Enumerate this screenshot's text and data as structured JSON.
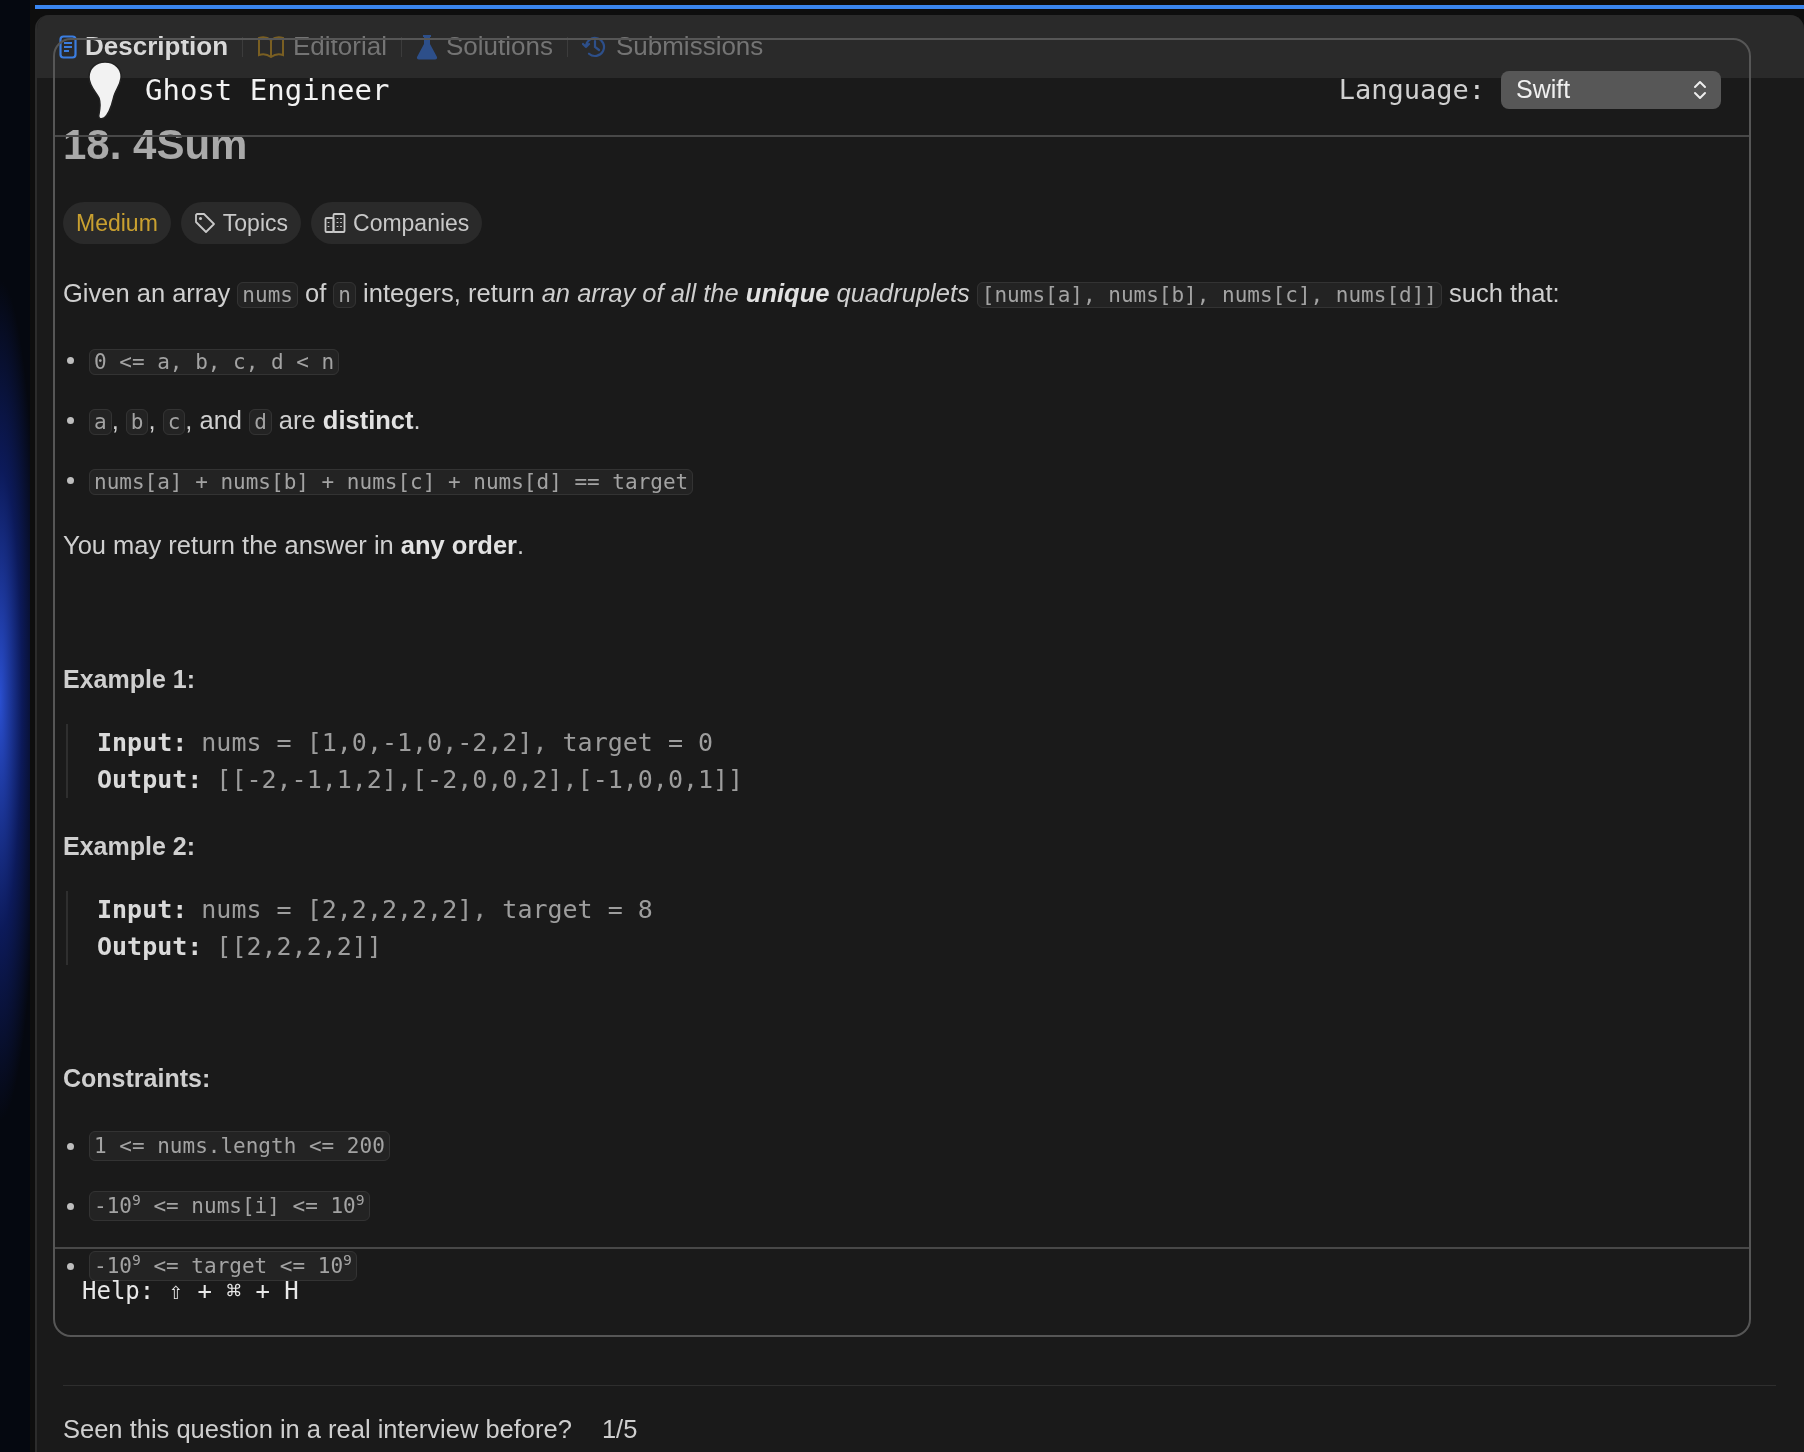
{
  "tabs": [
    {
      "label": "Description",
      "selected": true
    },
    {
      "label": "Editorial",
      "selected": false
    },
    {
      "label": "Solutions",
      "selected": false
    },
    {
      "label": "Submissions",
      "selected": false
    }
  ],
  "overlay": {
    "title": "Ghost Engineer",
    "language_label": "Language:",
    "language": "Swift",
    "help": "Help: ⇧ + ⌘ + H"
  },
  "problem": {
    "title": "18. 4Sum",
    "tags": [
      {
        "label": "Medium",
        "kind": "difficulty"
      },
      {
        "label": "Topics",
        "kind": "topics"
      },
      {
        "label": "Companies",
        "kind": "companies"
      }
    ],
    "statement": [
      {
        "t": "Given an array ",
        "kind": "text"
      },
      {
        "t": "nums",
        "kind": "code"
      },
      {
        "t": " of ",
        "kind": "text"
      },
      {
        "t": "n",
        "kind": "code"
      },
      {
        "t": " integers, return ",
        "kind": "text"
      },
      {
        "t": "an array of all the ",
        "kind": "em"
      },
      {
        "t": "unique",
        "kind": "strong-em"
      },
      {
        "t": " quadruplets ",
        "kind": "em"
      },
      {
        "t": "[nums[a], nums[b], nums[c], nums[d]]",
        "kind": "code"
      },
      {
        "t": " such that:",
        "kind": "text"
      }
    ],
    "conditions": [
      [
        {
          "t": "0 <= a, b, c, d < n",
          "kind": "code"
        }
      ],
      [
        {
          "t": "a",
          "kind": "code"
        },
        {
          "t": ", ",
          "kind": "text"
        },
        {
          "t": "b",
          "kind": "code"
        },
        {
          "t": ", ",
          "kind": "text"
        },
        {
          "t": "c",
          "kind": "code"
        },
        {
          "t": ", and ",
          "kind": "text"
        },
        {
          "t": "d",
          "kind": "code"
        },
        {
          "t": " are ",
          "kind": "text"
        },
        {
          "t": "distinct",
          "kind": "strong"
        },
        {
          "t": ".",
          "kind": "text"
        }
      ],
      [
        {
          "t": "nums[a] + nums[b] + nums[c] + nums[d] == target",
          "kind": "code"
        }
      ]
    ],
    "note": [
      {
        "t": "You may return the answer in ",
        "kind": "text"
      },
      {
        "t": "any order",
        "kind": "strong"
      },
      {
        "t": ".",
        "kind": "text"
      }
    ],
    "examples": [
      {
        "heading": "Example 1:",
        "input_label": "Input:",
        "input": "nums = [1,0,-1,0,-2,2], target = 0",
        "output_label": "Output:",
        "output": "[[-2,-1,1,2],[-2,0,0,2],[-1,0,0,1]]"
      },
      {
        "heading": "Example 2:",
        "input_label": "Input:",
        "input": "nums = [2,2,2,2,2], target = 8",
        "output_label": "Output:",
        "output": "[[2,2,2,2]]"
      }
    ],
    "constraints_heading": "Constraints:",
    "constraints": [
      "1 <= nums.length <= 200",
      "-10$^{9}$ <= nums[i] <= 10$^{9}$",
      "-10$^{9}$ <= target <= 10$^{9}$"
    ]
  },
  "feedback": {
    "question": "Seen this question in a real interview before?",
    "count": "1/5"
  }
}
